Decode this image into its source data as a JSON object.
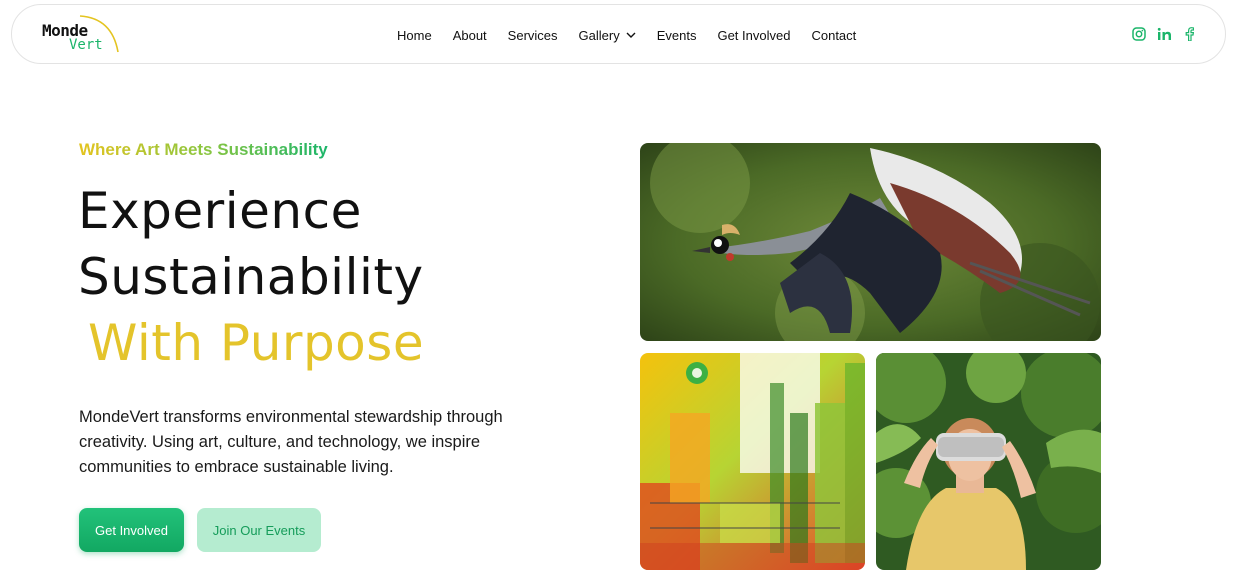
{
  "brand": {
    "logo_line1": "Monde",
    "logo_line2": "Vert"
  },
  "nav": {
    "items": [
      {
        "label": "Home"
      },
      {
        "label": "About"
      },
      {
        "label": "Services"
      },
      {
        "label": "Gallery"
      },
      {
        "label": "Events"
      },
      {
        "label": "Get Involved"
      },
      {
        "label": "Contact"
      }
    ],
    "socials": [
      "instagram-icon",
      "linkedin-icon",
      "facebook-icon"
    ]
  },
  "hero": {
    "tagline": "Where Art Meets Sustainability",
    "title_line1": "Experience",
    "title_line2": "Sustainability",
    "title_accent": "With Purpose",
    "description": "MondeVert transforms environmental stewardship through creativity. Using art, culture, and technology, we inspire communities to embrace sustainable living.",
    "primary_button": "Get Involved",
    "secondary_button": "Join Our Events"
  },
  "colors": {
    "brand_green": "#1bb56a",
    "accent_yellow": "#e4c42b",
    "secondary_button_bg": "#b5ecd0"
  }
}
